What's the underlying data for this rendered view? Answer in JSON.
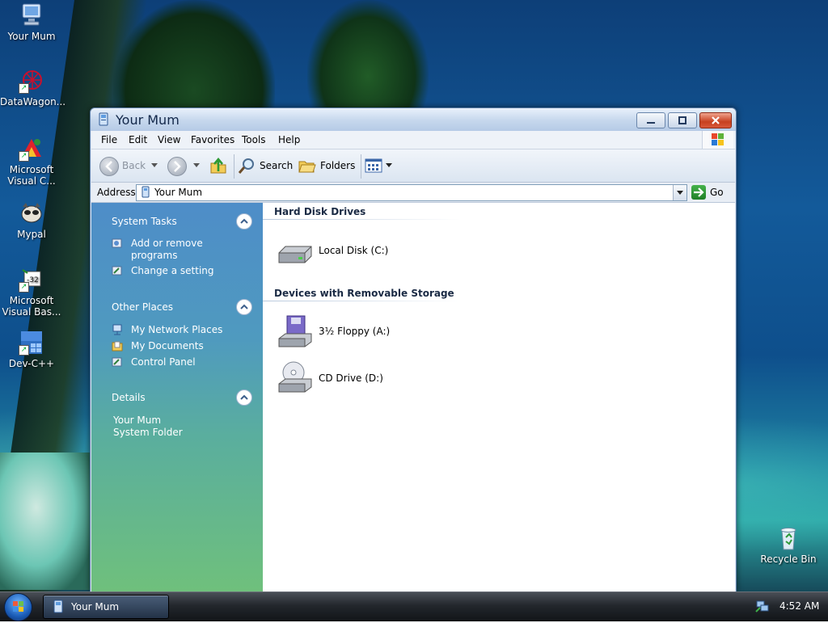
{
  "desktop": {
    "icons": [
      {
        "label": "Your Mum",
        "icon": "computer-icon"
      },
      {
        "label": "DataWagon...",
        "icon": "datawagon-icon"
      },
      {
        "label": "Microsoft Visual C...",
        "icon": "visual-c-icon"
      },
      {
        "label": "Mypal",
        "icon": "mypal-icon"
      },
      {
        "label": "Microsoft Visual Bas...",
        "icon": "visual-basic-icon"
      },
      {
        "label": "Dev-C++",
        "icon": "dev-cpp-icon"
      },
      {
        "label": "Recycle Bin",
        "icon": "recycle-bin-icon"
      }
    ]
  },
  "window": {
    "title": "Your Mum",
    "menu": [
      "File",
      "Edit",
      "View",
      "Favorites",
      "Tools",
      "Help"
    ],
    "toolbar": {
      "back": "Back",
      "search": "Search",
      "folders": "Folders"
    },
    "address": {
      "label": "Address",
      "value": "Your Mum",
      "go": "Go"
    },
    "left_pane": {
      "system_tasks": {
        "title": "System Tasks",
        "items": [
          "Add or remove programs",
          "Change a setting"
        ]
      },
      "other_places": {
        "title": "Other Places",
        "items": [
          "My Network Places",
          "My Documents",
          "Control Panel"
        ]
      },
      "details": {
        "title": "Details",
        "name": "Your Mum",
        "type": "System Folder"
      }
    },
    "content": {
      "hard_disk_header": "Hard Disk Drives",
      "local_disk": "Local Disk (C:)",
      "removable_header": "Devices with Removable Storage",
      "floppy": "3½ Floppy (A:)",
      "cd_drive": "CD Drive (D:)"
    }
  },
  "taskbar": {
    "task_button": "Your Mum",
    "clock": "4:52 AM"
  },
  "colors": {
    "left_pane_top": "#4e8dc8",
    "left_pane_bottom": "#6fc07c",
    "close_button": "#c7401f"
  }
}
